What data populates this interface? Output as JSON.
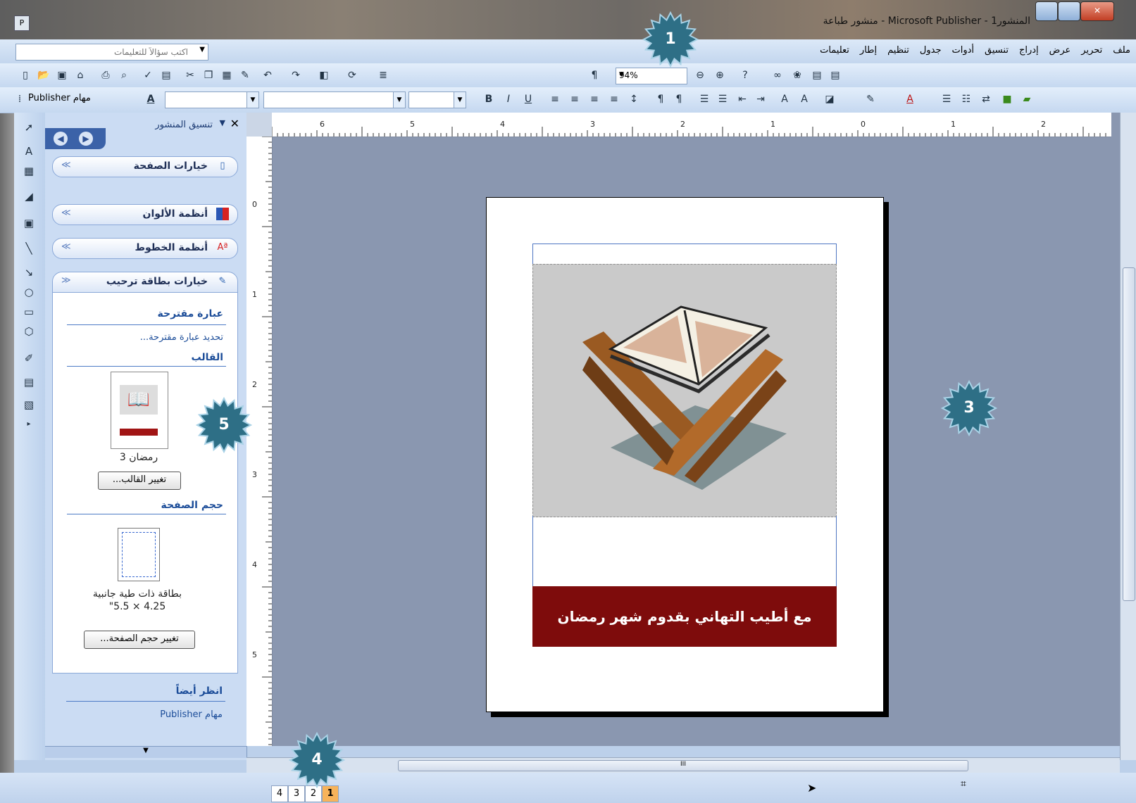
{
  "window": {
    "title": "المنشور1 - Microsoft Publisher - منشور طباعة",
    "app_icon": "publisher-icon",
    "controls": [
      "minimize-icon",
      "maximize-icon",
      "close-icon"
    ]
  },
  "menubar": {
    "items": [
      "ملف",
      "تحرير",
      "عرض",
      "إدراج",
      "تنسيق",
      "أدوات",
      "جدول",
      "تنظيم",
      "إطار",
      "تعليمات"
    ],
    "ask_placeholder": "اكتب سؤالاً للتعليمات"
  },
  "standard_toolbar": {
    "zoom": "94%"
  },
  "format_toolbar": {
    "tasks_label": "مهام Publisher"
  },
  "task_pane": {
    "title": "تنسيق المنشور",
    "sections": [
      {
        "label": "خيارات الصفحة",
        "icon": "page-icon"
      },
      {
        "label": "أنظمة الألوان",
        "icon": "color-scheme-icon"
      },
      {
        "label": "أنظمة الخطوط",
        "icon": "font-scheme-icon"
      },
      {
        "label": "خيارات بطاقة ترحيب",
        "icon": "card-options-icon"
      }
    ],
    "suggested_heading": "عبارة مقترحة",
    "suggested_link": "تحديد عبارة مقترحة...",
    "template_heading": "القالب",
    "template_name": "رمضان 3",
    "change_template": "تغيير القالب...",
    "page_size_heading": "حجم الصفحة",
    "page_size_name": "بطاقة ذات طية جانبية",
    "page_size_dims": "\"5.5 × 4.25",
    "change_page_size": "تغيير حجم الصفحة...",
    "see_also_heading": "انظر أيضاً",
    "see_also_link": "مهام Publisher"
  },
  "canvas": {
    "banner_text": "مع أطيب التهاني بقدوم شهر رمضان",
    "ruler_labels": [
      "6",
      "5",
      "4",
      "3",
      "2",
      "1",
      "0",
      "1",
      "2"
    ],
    "vruler_labels": [
      "0",
      "1",
      "2",
      "3",
      "4",
      "5"
    ]
  },
  "page_tabs": [
    "4",
    "3",
    "2",
    "1"
  ],
  "callouts": [
    "1",
    "3",
    "4",
    "5"
  ],
  "colors": {
    "banner": "#7e0c0c",
    "workspace": "#8a97b0",
    "callout": "#2e6f86"
  }
}
